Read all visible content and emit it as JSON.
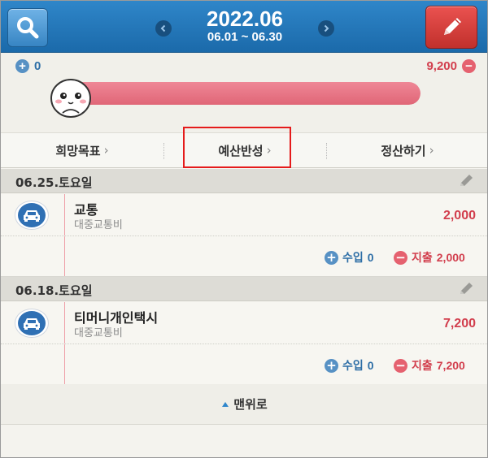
{
  "header": {
    "month": "2022.06",
    "range": "06.01 ~ 06.30",
    "search_icon": "search-icon",
    "edit_icon": "pencil-icon",
    "prev_icon": "chevron-left-icon",
    "next_icon": "chevron-right-icon"
  },
  "balance": {
    "income": "0",
    "expense": "9,200",
    "expense_fraction": 1.0,
    "colors": {
      "income": "#2d6ea6",
      "expense": "#d23e4d",
      "bar": "#e56b7c"
    }
  },
  "tabs": [
    {
      "label": "희망목표"
    },
    {
      "label": "예산반성"
    },
    {
      "label": "정산하기"
    }
  ],
  "days": [
    {
      "date": "06.25.토요일",
      "entries": [
        {
          "title": "교통",
          "subtitle": "대중교통비",
          "amount": "2,000",
          "icon": "car-icon"
        }
      ],
      "summary": {
        "income_label": "수입",
        "income": "0",
        "expense_label": "지출",
        "expense": "2,000"
      }
    },
    {
      "date": "06.18.토요일",
      "entries": [
        {
          "title": "티머니개인택시",
          "subtitle": "대중교통비",
          "amount": "7,200",
          "icon": "car-icon"
        }
      ],
      "summary": {
        "income_label": "수입",
        "income": "0",
        "expense_label": "지출",
        "expense": "7,200"
      }
    }
  ],
  "footer": {
    "to_top": "맨위로"
  }
}
